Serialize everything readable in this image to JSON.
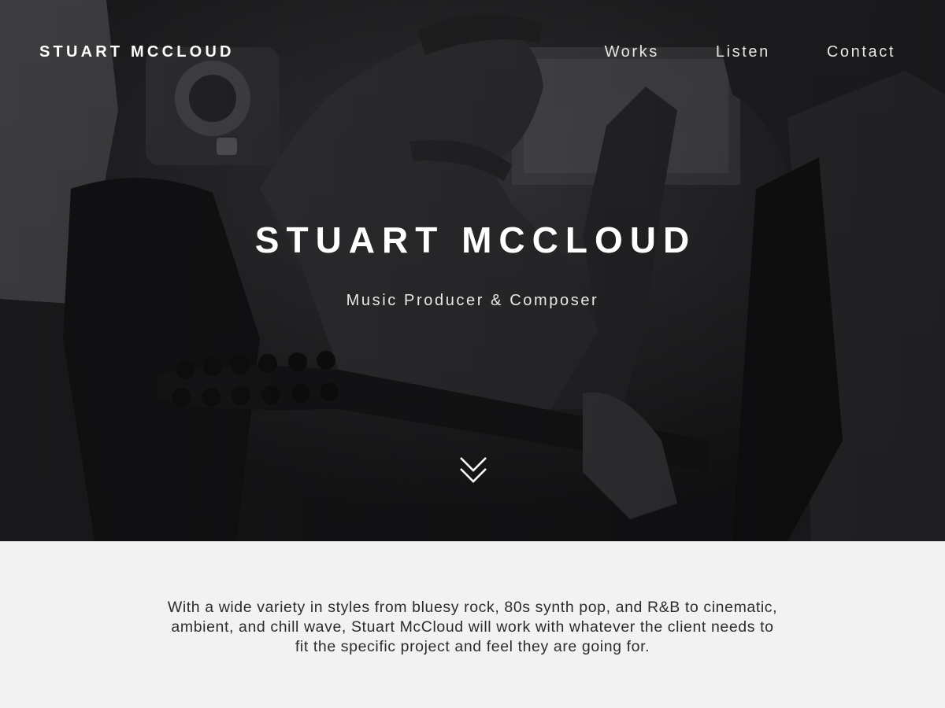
{
  "nav": {
    "brand": "STUART MCCLOUD",
    "links": [
      "Works",
      "Listen",
      "Contact"
    ]
  },
  "hero": {
    "title": "STUART MCCLOUD",
    "subtitle": "Music Producer & Composer",
    "scroll_icon": "double-chevron-down-icon"
  },
  "about": {
    "text": "With a wide variety in styles from bluesy rock, 80s synth pop, and R&B to cinematic, ambient, and chill wave, Stuart McCloud will work with whatever the client needs to fit the specific project and feel they are going for."
  },
  "colors": {
    "hero_background": "#1b1b1d",
    "hero_text": "#ffffff",
    "page_background": "#f2f2f2",
    "body_text": "#2c2c2c"
  }
}
